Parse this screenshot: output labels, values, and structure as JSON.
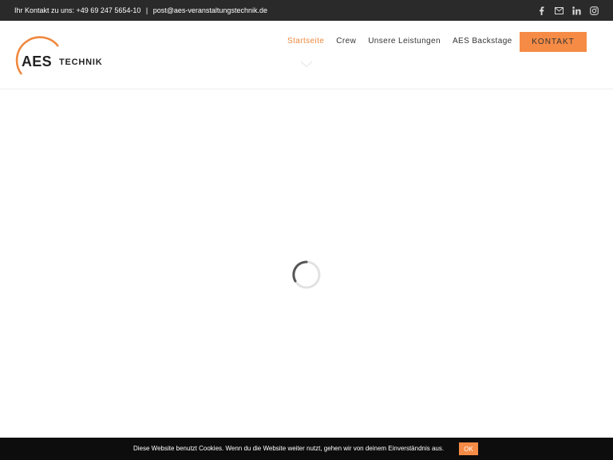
{
  "topbar": {
    "contact_label": "Ihr Kontakt zu uns: +49 69 247 5654-10",
    "separator": "|",
    "email": "post@aes-veranstaltungstechnik.de",
    "social_icons": [
      "facebook-icon",
      "mail-icon",
      "linkedin-icon",
      "instagram-icon"
    ]
  },
  "logo": {
    "brand": "AES",
    "tagline": "TECHNIK",
    "accent_color": "#f0883e"
  },
  "nav": {
    "items": [
      {
        "label": "Startseite",
        "active": true
      },
      {
        "label": "Crew"
      },
      {
        "label": "Unsere Leistungen"
      },
      {
        "label": "AES Backstage"
      }
    ],
    "cta_label": "KONTAKT"
  },
  "colors": {
    "accent": "#f58b45",
    "topbar_bg": "#2a2a2a",
    "cookie_bg": "#0d0d0d"
  },
  "cookie": {
    "message": "Diese Website benutzt Cookies. Wenn du die Website weiter nutzt, gehen wir von deinem Einverständnis aus.",
    "ok_label": "OK"
  }
}
